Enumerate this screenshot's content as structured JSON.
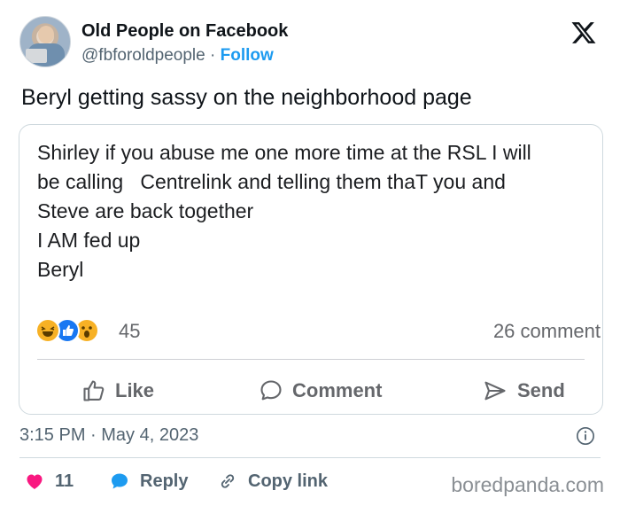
{
  "author": {
    "name": "Old People on Facebook",
    "handle": "@fbforoldpeople",
    "separator": "·",
    "follow_label": "Follow"
  },
  "tweet": {
    "text": "Beryl getting sassy on the neighborhood page"
  },
  "facebook_post": {
    "lines": [
      "Shirley if you abuse me one more time at the RSL I will",
      "be calling   Centrelink and telling them thaT you and",
      "Steve are back together",
      "I AM fed up",
      "Beryl"
    ],
    "reaction_icons": [
      "haha-reaction-icon",
      "like-reaction-icon",
      "wow-reaction-icon"
    ],
    "reaction_count": "45",
    "comment_count": "26 comment",
    "actions": {
      "like": "Like",
      "comment": "Comment",
      "send": "Send"
    }
  },
  "meta": {
    "timestamp": "3:15 PM · May 4, 2023"
  },
  "footer": {
    "likes": "11",
    "reply": "Reply",
    "copy_link": "Copy link"
  },
  "watermark": "boredpanda.com",
  "colors": {
    "accent_blue": "#1d9bf0",
    "heart_red": "#f91880",
    "facebook_blue": "#1877f2",
    "muted_text": "#536471"
  }
}
